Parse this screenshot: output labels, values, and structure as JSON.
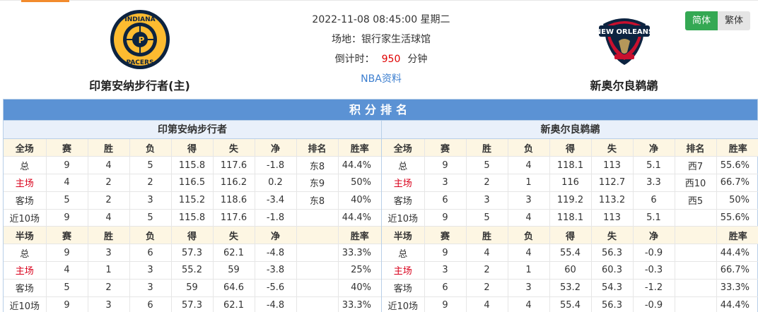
{
  "match": {
    "datetime": "2022-11-08 08:45:00 星期二",
    "venue": "场地：银行家生活球馆",
    "countdown_label": "倒计时：",
    "countdown_value": "950",
    "countdown_unit": "分钟",
    "nba_link": "NBA资料"
  },
  "home_team": {
    "name": "印第安纳步行者(主)",
    "logo_icon": "pacers-logo-icon"
  },
  "away_team": {
    "name": "新奥尔良鹈鹕",
    "logo_icon": "pelicans-logo-icon"
  },
  "lang": {
    "simplified": "简体",
    "traditional": "繁体"
  },
  "ranking": {
    "title": "积分排名",
    "home_panel_title": "印第安纳步行者",
    "away_panel_title": "新奥尔良鹈鹕",
    "full_headers": [
      "全场",
      "赛",
      "胜",
      "负",
      "得",
      "失",
      "净",
      "排名",
      "胜率"
    ],
    "half_headers": [
      "半场",
      "赛",
      "胜",
      "负",
      "得",
      "失",
      "净",
      "",
      "胜率"
    ],
    "home_full": [
      [
        "总",
        "9",
        "4",
        "5",
        "115.8",
        "117.6",
        "-1.8",
        "东8",
        "44.4%"
      ],
      [
        "主场",
        "4",
        "2",
        "2",
        "116.5",
        "116.2",
        "0.2",
        "东9",
        "50%"
      ],
      [
        "客场",
        "5",
        "2",
        "3",
        "115.2",
        "118.6",
        "-3.4",
        "东8",
        "40%"
      ],
      [
        "近10场",
        "9",
        "4",
        "5",
        "115.8",
        "117.6",
        "-1.8",
        "",
        "44.4%"
      ]
    ],
    "home_half": [
      [
        "总",
        "9",
        "3",
        "6",
        "57.3",
        "62.1",
        "-4.8",
        "",
        "33.3%"
      ],
      [
        "主场",
        "4",
        "1",
        "3",
        "55.2",
        "59",
        "-3.8",
        "",
        "25%"
      ],
      [
        "客场",
        "5",
        "2",
        "3",
        "59",
        "64.6",
        "-5.6",
        "",
        "40%"
      ],
      [
        "近10场",
        "9",
        "3",
        "6",
        "57.3",
        "62.1",
        "-4.8",
        "",
        "33.3%"
      ]
    ],
    "away_full": [
      [
        "总",
        "9",
        "5",
        "4",
        "118.1",
        "113",
        "5.1",
        "西7",
        "55.6%"
      ],
      [
        "主场",
        "3",
        "2",
        "1",
        "116",
        "112.7",
        "3.3",
        "西10",
        "66.7%"
      ],
      [
        "客场",
        "6",
        "3",
        "3",
        "119.2",
        "113.2",
        "6",
        "西5",
        "50%"
      ],
      [
        "近10场",
        "9",
        "5",
        "4",
        "118.1",
        "113",
        "5.1",
        "",
        "55.6%"
      ]
    ],
    "away_half": [
      [
        "总",
        "9",
        "4",
        "4",
        "55.4",
        "56.3",
        "-0.9",
        "",
        "44.4%"
      ],
      [
        "主场",
        "3",
        "2",
        "1",
        "60",
        "60.3",
        "-0.3",
        "",
        "66.7%"
      ],
      [
        "客场",
        "6",
        "2",
        "3",
        "53.2",
        "54.3",
        "-1.2",
        "",
        "33.3%"
      ],
      [
        "近10场",
        "9",
        "4",
        "4",
        "55.4",
        "56.3",
        "-0.9",
        "",
        "44.4%"
      ]
    ]
  }
}
